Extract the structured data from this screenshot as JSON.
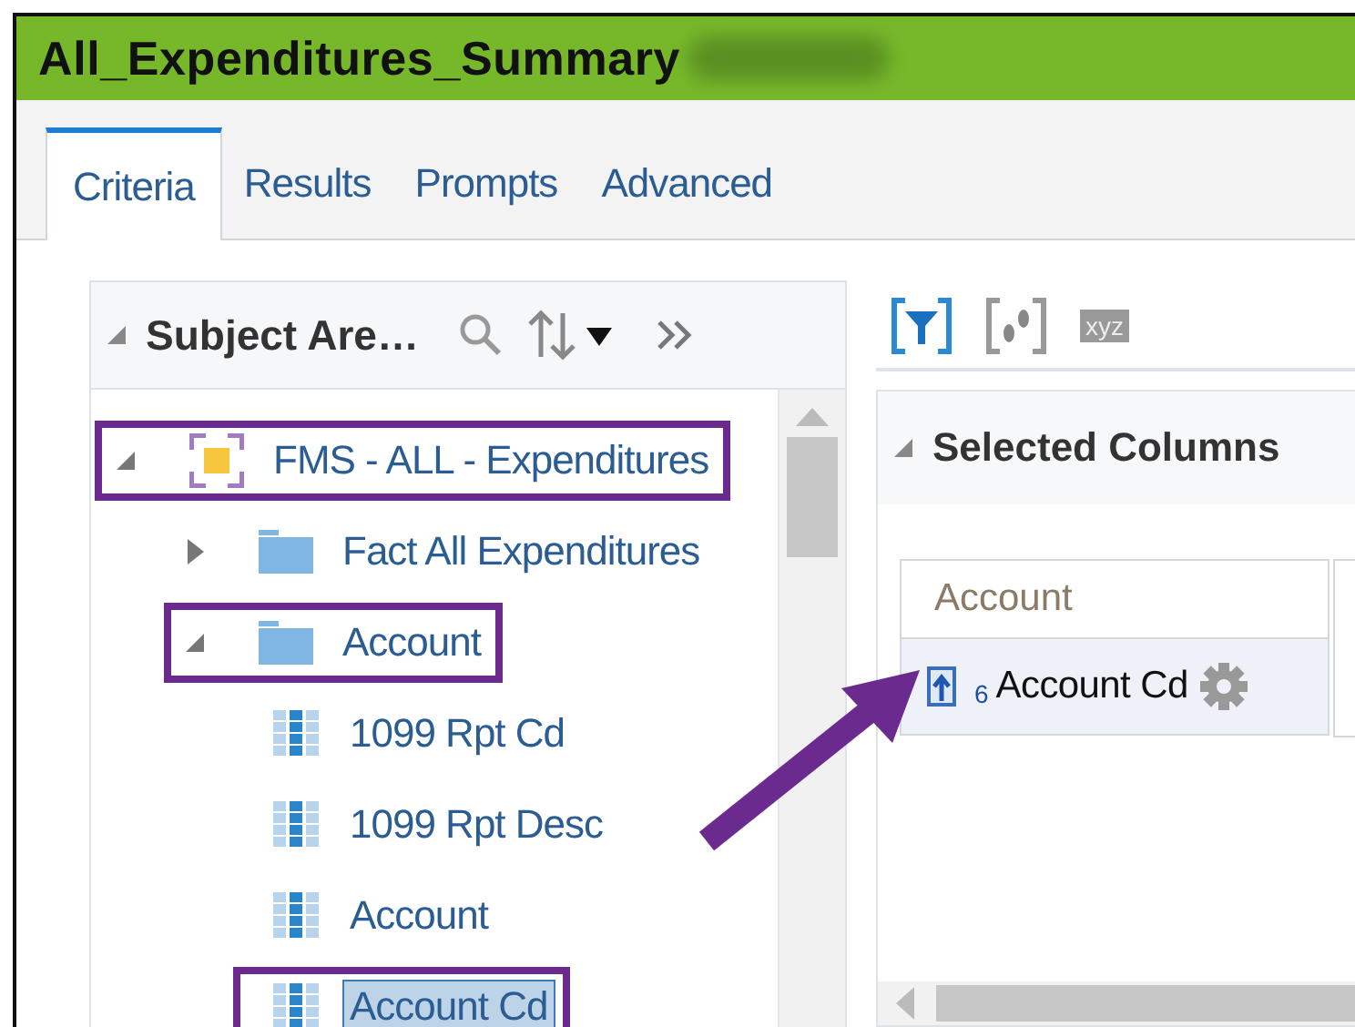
{
  "window": {
    "title": "All_Expenditures_Summary"
  },
  "tabs": [
    {
      "label": "Criteria",
      "selected": true
    },
    {
      "label": "Results",
      "selected": false
    },
    {
      "label": "Prompts",
      "selected": false
    },
    {
      "label": "Advanced",
      "selected": false
    }
  ],
  "subject_areas": {
    "title": "Subject Are…",
    "expanded": true,
    "tree": [
      {
        "label": "FMS - ALL - Expenditures",
        "kind": "subject_area",
        "expanded": true,
        "annotated": true,
        "selected": false,
        "children": [
          {
            "label": "Fact All Expenditures",
            "kind": "folder",
            "expanded": false,
            "annotated": false,
            "selected": false
          },
          {
            "label": "Account",
            "kind": "folder",
            "expanded": true,
            "annotated": true,
            "selected": false,
            "children": [
              {
                "label": "1099 Rpt Cd",
                "kind": "column",
                "annotated": false,
                "selected": false
              },
              {
                "label": "1099 Rpt Desc",
                "kind": "column",
                "annotated": false,
                "selected": false
              },
              {
                "label": "Account",
                "kind": "column",
                "annotated": false,
                "selected": false
              },
              {
                "label": "Account Cd",
                "kind": "column",
                "annotated": true,
                "selected": true
              }
            ]
          }
        ]
      }
    ]
  },
  "toolbar": {
    "text_button": "xyz"
  },
  "selected_columns": {
    "title": "Selected Columns",
    "expanded": true,
    "columns": [
      {
        "folder": "Account",
        "order": "6",
        "name": "Account Cd"
      }
    ]
  }
}
